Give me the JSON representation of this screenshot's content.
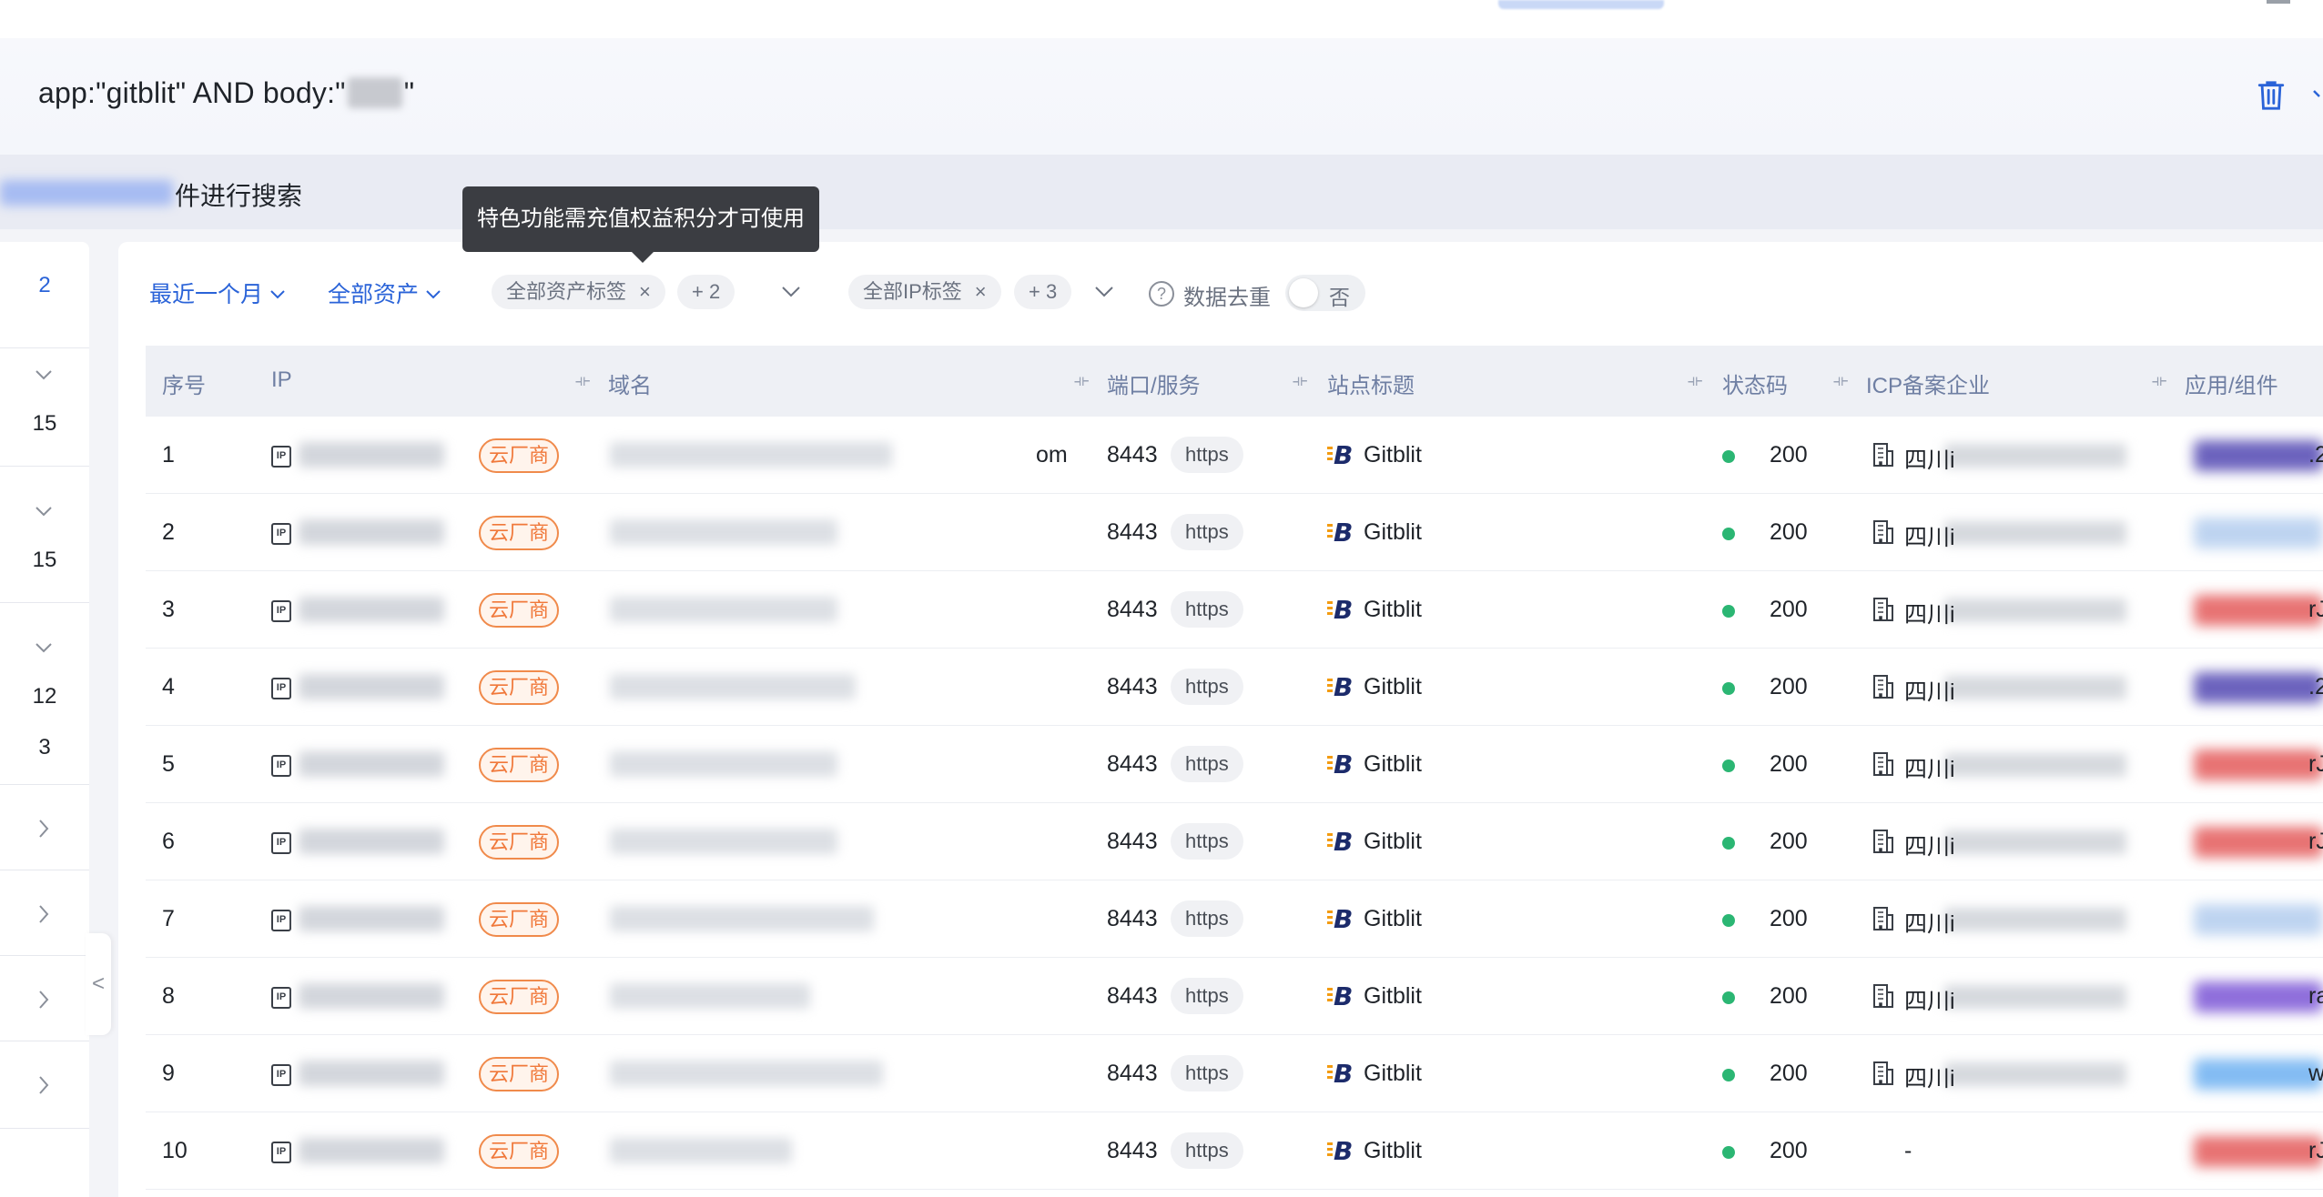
{
  "query": {
    "prefix": "app:\"gitblit\" AND body:\"",
    "suffix": "\""
  },
  "hint": {
    "text": "件进行搜索"
  },
  "tooltip": {
    "text": "特色功能需充值权益积分才可使用"
  },
  "filters": {
    "time_range": "最近一个月",
    "asset_scope": "全部资产",
    "asset_tag": "全部资产标签",
    "asset_tag_more": "+ 2",
    "ip_tag": "全部IP标签",
    "ip_tag_more": "+ 3",
    "dedup_label": "数据去重",
    "dedup_value": "否",
    "help_icon": "?",
    "close_symbol": "×"
  },
  "sidebar": {
    "items": [
      "2",
      "15",
      "15",
      "12",
      "3"
    ],
    "collapse_symbol": "<"
  },
  "table": {
    "columns": [
      "序号",
      "IP",
      "域名",
      "端口/服务",
      "站点标题",
      "状态码",
      "ICP备案企业",
      "应用/组件"
    ],
    "cloud_badge": "云厂商",
    "ip_icon_label": "IP",
    "rows": [
      {
        "index": "1",
        "domain_tail": "om",
        "port": "8443",
        "service": "https",
        "title": "Gitblit",
        "status": "200",
        "icp": "四川i",
        "app_tail": ".2",
        "app_color": "#3b2fa8"
      },
      {
        "index": "2",
        "domain_tail": "",
        "port": "8443",
        "service": "https",
        "title": "Gitblit",
        "status": "200",
        "icp": "四川i",
        "app_tail": "",
        "app_color": "#a9c6ec"
      },
      {
        "index": "3",
        "domain_tail": "",
        "port": "8443",
        "service": "https",
        "title": "Gitblit",
        "status": "200",
        "icp": "四川i",
        "app_tail": "rJ",
        "app_color": "#e04545"
      },
      {
        "index": "4",
        "domain_tail": "",
        "port": "8443",
        "service": "https",
        "title": "Gitblit",
        "status": "200",
        "icp": "四川i",
        "app_tail": ".2",
        "app_color": "#3b2fa8"
      },
      {
        "index": "5",
        "domain_tail": "",
        "port": "8443",
        "service": "https",
        "title": "Gitblit",
        "status": "200",
        "icp": "四川i",
        "app_tail": "rJ",
        "app_color": "#e04545"
      },
      {
        "index": "6",
        "domain_tail": "",
        "port": "8443",
        "service": "https",
        "title": "Gitblit",
        "status": "200",
        "icp": "四川i",
        "app_tail": "rJ",
        "app_color": "#e04545"
      },
      {
        "index": "7",
        "domain_tail": "",
        "port": "8443",
        "service": "https",
        "title": "Gitblit",
        "status": "200",
        "icp": "四川i",
        "app_tail": "",
        "app_color": "#a9c6ec"
      },
      {
        "index": "8",
        "domain_tail": "",
        "port": "8443",
        "service": "https",
        "title": "Gitblit",
        "status": "200",
        "icp": "四川i",
        "app_tail": "ra",
        "app_color": "#6a3fd0"
      },
      {
        "index": "9",
        "domain_tail": "",
        "port": "8443",
        "service": "https",
        "title": "Gitblit",
        "status": "200",
        "icp": "四川i",
        "app_tail": "we",
        "app_color": "#5aa6ef"
      },
      {
        "index": "10",
        "domain_tail": "",
        "port": "8443",
        "service": "https",
        "title": "Gitblit",
        "status": "200",
        "icp": "-",
        "app_tail": "rJ",
        "app_color": "#e04545"
      }
    ]
  },
  "colors": {
    "accent": "#2a63d8",
    "status_ok": "#2bb673",
    "cloud_badge": "#f0783a"
  }
}
